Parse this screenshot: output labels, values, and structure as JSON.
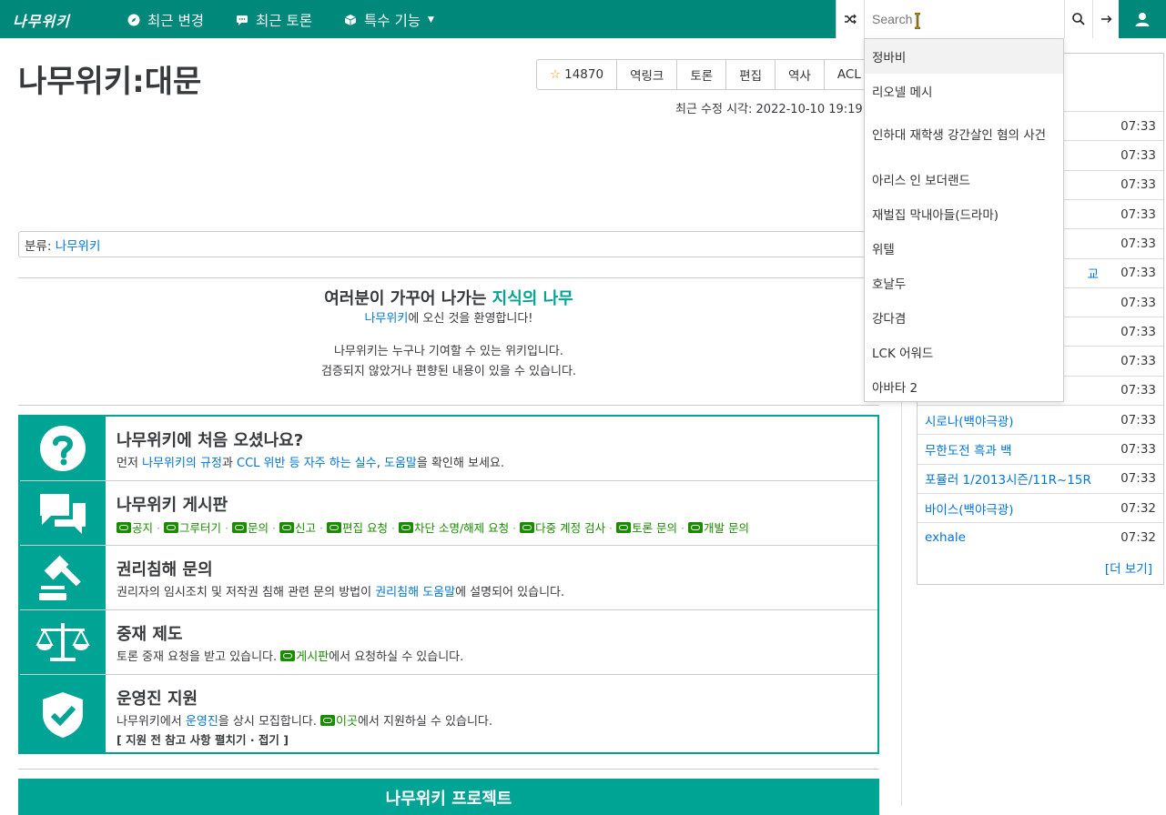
{
  "nav": {
    "logo": "나무위키",
    "items": [
      "최근 변경",
      "최근 토론",
      "특수 기능"
    ],
    "search_placeholder": "Search"
  },
  "dropdown": [
    "정바비",
    "리오넬 메시",
    "인하대 재학생 강간살인 혐의 사건",
    "아리스 인 보더랜드",
    "재벌집 막내아들(드라마)",
    "위텔",
    "호날두",
    "강다겸",
    "LCK 어워드",
    "아바타 2"
  ],
  "page": {
    "title": "나무위키:대문",
    "tools": {
      "star_count": "14870",
      "backlinks": "역링크",
      "discuss": "토론",
      "edit": "편집",
      "history": "역사",
      "acl": "ACL"
    },
    "last_modified": "최근 수정 시각: 2022-10-10 19:19:",
    "category_label": "분류: ",
    "category_link": "나무위키"
  },
  "welcome": {
    "line1_prefix": "여러분이 가꾸어 나가는 ",
    "line1_hl": "지식의 나무",
    "line2_link": "나무위키",
    "line2_rest": "에 오신 것을 환영합니다!",
    "line3": "나무위키는 누구나 기여할 수 있는 위키입니다.",
    "line4": "검증되지 않았거나 편향된 내용이 있을 수 있습니다."
  },
  "info": {
    "first": {
      "title": "나무위키에 처음 오셨나요?",
      "d1": "먼저 ",
      "l1": "나무위키의 규정",
      "d2": "과 ",
      "l2": "CCL 위반 등 자주 하는 실수",
      "d3": ", ",
      "l3": "도움말",
      "d4": "을 확인해 보세요."
    },
    "board": {
      "title": "나무위키 게시판",
      "links": [
        "공지",
        "그루터기",
        "문의",
        "신고",
        "편집 요청",
        "차단 소명/해제 요청",
        "다중 계정 검사",
        "토론 문의",
        "개발 문의"
      ]
    },
    "rights": {
      "title": "권리침해 문의",
      "d1": "권리자의 임시조치 및 저작권 침해 관련 문의 방법이 ",
      "l1": "권리침해 도움말",
      "d2": "에 설명되어 있습니다."
    },
    "mediation": {
      "title": "중재 제도",
      "d1": "토론 중재 요청을 받고 있습니다. ",
      "l1": "게시판",
      "d2": "에서 요청하실 수 있습니다."
    },
    "staff": {
      "title": "운영진 지원",
      "d1": "나무위키에서 ",
      "l1": "운영진",
      "d2": "을 상시 모집합니다. ",
      "l2": "이곳",
      "d3": "에서 지원하실 수 있습니다.",
      "fold": "[ 지원 전 참고 사항 펼치기 · 접기 ]"
    }
  },
  "project_banner": "나무위키 프로젝트",
  "recent": {
    "rows": [
      {
        "name": "",
        "time": "07:33"
      },
      {
        "name": "",
        "time": "07:33"
      },
      {
        "name": "",
        "time": "07:33"
      },
      {
        "name": "",
        "time": "07:33"
      },
      {
        "name": "",
        "time": "07:33"
      },
      {
        "name": "교",
        "time": "07:33"
      },
      {
        "name": "",
        "time": "07:33"
      },
      {
        "name": "",
        "time": "07:33"
      },
      {
        "name": "",
        "time": "07:33"
      },
      {
        "name": "",
        "time": "07:33"
      },
      {
        "name": "시로나(백야극광)",
        "time": "07:33"
      },
      {
        "name": "무한도전 흑과 백",
        "time": "07:33"
      },
      {
        "name": "포뮬러 1/2013시즌/11R~15R",
        "time": "07:33"
      },
      {
        "name": "바이스(백야극광)",
        "time": "07:32"
      },
      {
        "name": "exhale",
        "time": "07:32"
      }
    ],
    "more": "[더 보기]"
  }
}
